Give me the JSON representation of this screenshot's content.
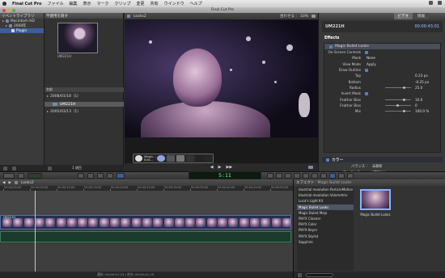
{
  "menubar": {
    "app_name": "Final Cut Pro",
    "items": [
      "ファイル",
      "編集",
      "表示",
      "マーク",
      "クリップ",
      "変更",
      "共有",
      "ウインドウ",
      "ヘルプ"
    ]
  },
  "window_title": "Final Cut Pro",
  "library": {
    "header": "イベントライブラリ",
    "items": [
      {
        "label": "Macintosh HD",
        "indent": 0
      },
      {
        "label": "2008年",
        "indent": 1
      },
      {
        "label": "Plugin",
        "indent": 2,
        "selected": true
      }
    ]
  },
  "browser": {
    "header_label": "不使用を隠す",
    "thumb_label": "UM221H",
    "sort_label": "名前",
    "dates": [
      {
        "label": "2008/01/18（1）"
      },
      {
        "label": "2005/03/13（1）"
      }
    ],
    "clip_row": "UM221H",
    "count_label": "1 項目"
  },
  "viewer": {
    "title": "Looks2",
    "fit_label": "合わせる :",
    "zoom": "33%",
    "hud_label1": "Magic...",
    "hud_label2": "Edit..."
  },
  "inspector": {
    "tabs": [
      "ビデオ",
      "情報"
    ],
    "clip_name": "UM221H",
    "clip_timecode": "00:00:43:01",
    "effects_header": "Effects",
    "effect_name": "Magic Bullet Looks",
    "params": [
      {
        "label": "On-Screen Controls",
        "value": ""
      },
      {
        "label": "Mask",
        "value": "None"
      },
      {
        "label": "View Mode",
        "value": "Apply"
      },
      {
        "label": "Draw Outline",
        "value": ""
      },
      {
        "label": "Top",
        "value": "0.23 px"
      },
      {
        "label": "Bottom",
        "value": "-0.25 px"
      },
      {
        "label": "Radius",
        "value": "25.0"
      },
      {
        "label": "Invert Mask",
        "value": ""
      },
      {
        "label": "Feather Bias",
        "value": "10.0"
      },
      {
        "label": "Feather Bias",
        "value": "0"
      },
      {
        "label": "Mix",
        "value": "100.0 %"
      }
    ],
    "color_header": "カラー",
    "balance_label": "バランス :",
    "balance_value": "未解析",
    "match_label": "マッチカラー :",
    "match_value": "選択...",
    "footer_label": "補正 1"
  },
  "toolbar": {
    "timecode": "5:11"
  },
  "timeline": {
    "title": "Looks2",
    "ruler_labels": [
      "00:00:00:00",
      "00:00:05:00",
      "00:00:10:00",
      "00:00:15:00",
      "00:00:20:00",
      "00:00:25:00",
      "00:00:30:00",
      "00:00:35:00",
      "00:00:40:00",
      "00:00:45:00",
      "00:00:50:00"
    ],
    "clip_label": "UM221H",
    "status": "選択: 00:00:41:15 / 合計: 00:00:41:15"
  },
  "effects": {
    "header": "エフェクト",
    "selected_title": "Magic Bullet Looks",
    "items": [
      "Idustrial revolution ParticleMotion",
      "Idustrial revolution Volumetrix",
      "Luca's Light Kit",
      "Magic Bullet Looks",
      "Magic Bullet Mojo",
      "PHYX Cleaner",
      "PHYX Color",
      "PHYX Keyer",
      "PHYX Stylist",
      "Sapphire"
    ],
    "thumb_label": "Magic Bullet Looks"
  }
}
